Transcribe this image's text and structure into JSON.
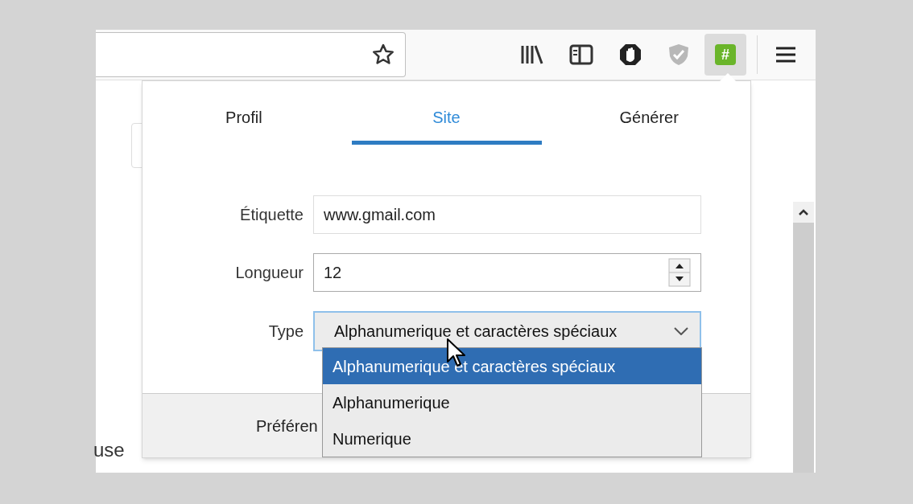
{
  "toolbar": {
    "icons": [
      {
        "kind": "library"
      },
      {
        "kind": "sidebar"
      },
      {
        "kind": "hand"
      },
      {
        "kind": "shield"
      },
      {
        "kind": "hash",
        "selected": true,
        "label": "#"
      }
    ]
  },
  "page": {
    "text": "use"
  },
  "popup": {
    "tabs": [
      {
        "label": "Profil",
        "selected": false
      },
      {
        "label": "Site",
        "selected": true
      },
      {
        "label": "Générer",
        "selected": false
      }
    ],
    "fields": [
      {
        "kind": "text",
        "label": "Étiquette",
        "value": "www.gmail.com"
      },
      {
        "kind": "number",
        "label": "Longueur",
        "value": "12"
      },
      {
        "kind": "select",
        "label": "Type",
        "value": "Alphanumerique et caractères spéciaux",
        "expanded": true,
        "options": [
          {
            "label": "Alphanumerique et caractères spéciaux",
            "selected": true
          },
          {
            "label": "Alphanumerique",
            "selected": false
          },
          {
            "label": "Numerique",
            "selected": false
          }
        ]
      }
    ],
    "footer": {
      "text": "Préféren"
    }
  }
}
